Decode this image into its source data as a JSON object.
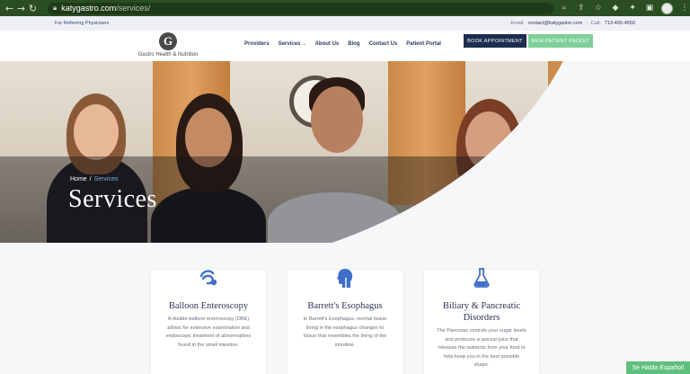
{
  "browser": {
    "url_host": "katygastro.com",
    "url_path": "/services/",
    "icons": [
      "back-icon",
      "forward-icon",
      "reload-icon",
      "lock-icon",
      "zoom-icon",
      "share-icon",
      "star-icon",
      "extension-icon",
      "puzzle-icon",
      "sidebar-icon",
      "profile-icon",
      "menu-icon"
    ]
  },
  "topbar": {
    "referring": "For Referring Physicians",
    "email_label": "Email:",
    "email_value": "contact@katygastro.com",
    "separator": "|",
    "call_label": "Call:",
    "call_value": "713-405-4550"
  },
  "header": {
    "logo_mark": "G",
    "logo_text": "Gastro Health & Nutrition",
    "nav": [
      {
        "label": "Providers"
      },
      {
        "label": "Services"
      },
      {
        "label": "About Us"
      },
      {
        "label": "Blog"
      },
      {
        "label": "Contact Us"
      },
      {
        "label": "Patient Portal"
      }
    ],
    "book_button": "BOOK APPOINTMENT",
    "packet_button": "NEW PATIENT PACKET"
  },
  "hero": {
    "breadcrumb_home": "Home",
    "breadcrumb_sep": "/",
    "breadcrumb_current": "Services",
    "title": "Services"
  },
  "services": [
    {
      "icon": "balloon-enteroscopy-icon",
      "title": "Balloon Enteroscopy",
      "description": "A double-balloon enteroscopy (DBE) allows for extensive examination and endoscopic treatment of abnormalities found in the small intestine."
    },
    {
      "icon": "esophagus-head-icon",
      "title": "Barrett's Esophagus",
      "description": "In Barrett's Esophagus, normal tissue lining in the esophagus changes to tissue that resembles the lining of the intestine."
    },
    {
      "icon": "flask-icon",
      "title": "Biliary & Pancreatic Disorders",
      "description": "The Pancreas controls your sugar levels and produces a special juice that releases the nutrients from your food to help keep you in the best possible shape."
    }
  ],
  "spanish_tab": "Se Habla Español!",
  "colors": {
    "accent_blue": "#3f6fc9",
    "navy": "#1d2d4f",
    "green": "#7fcf9a",
    "chrome_green": "#2b4d22"
  }
}
